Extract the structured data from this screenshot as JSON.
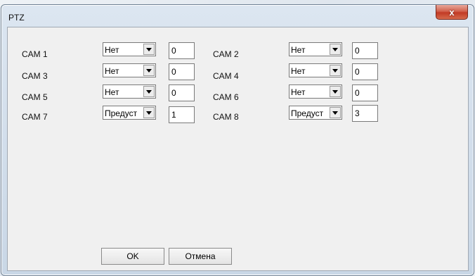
{
  "window": {
    "title": "PTZ",
    "close_label": "x"
  },
  "cams": [
    {
      "label": "CAM 1",
      "mode": "Нет",
      "value": "0"
    },
    {
      "label": "CAM 2",
      "mode": "Нет",
      "value": "0"
    },
    {
      "label": "CAM 3",
      "mode": "Нет",
      "value": "0"
    },
    {
      "label": "CAM 4",
      "mode": "Нет",
      "value": "0"
    },
    {
      "label": "CAM 5",
      "mode": "Нет",
      "value": "0"
    },
    {
      "label": "CAM 6",
      "mode": "Нет",
      "value": "0"
    },
    {
      "label": "CAM 7",
      "mode": "Предуст",
      "value": "1"
    },
    {
      "label": "CAM 8",
      "mode": "Предуст",
      "value": "3"
    }
  ],
  "buttons": {
    "ok_label": "OK",
    "cancel_label": "Отмена"
  }
}
